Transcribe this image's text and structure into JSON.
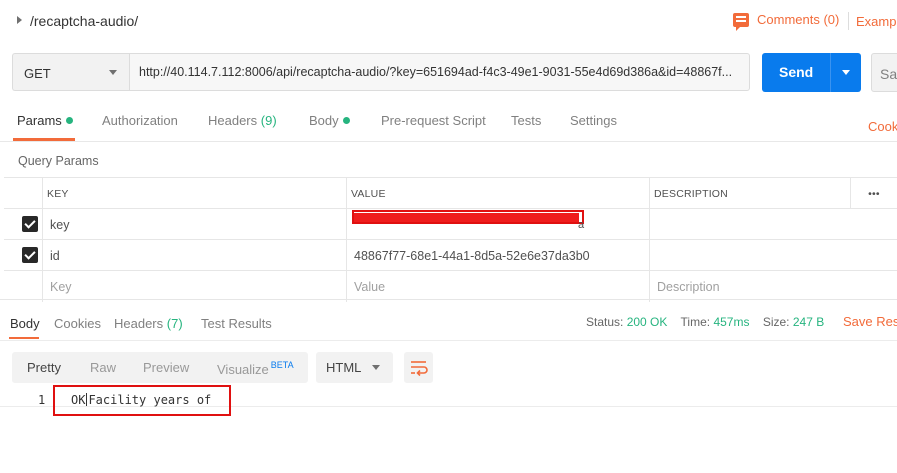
{
  "request": {
    "name": "/recaptcha-audio/",
    "comments_label": "Comments (0)",
    "examples_label": "Exampl",
    "method": "GET",
    "url": "http://40.114.7.112:8006/api/recaptcha-audio/?key=651694ad-f4c3-49e1-9031-55e4d69d386a&id=48867f...",
    "send_label": "Send",
    "save_label": "Sav"
  },
  "request_tabs": {
    "params": "Params",
    "authorization": "Authorization",
    "headers": "Headers",
    "headers_count": "(9)",
    "body": "Body",
    "prerequest": "Pre-request Script",
    "tests": "Tests",
    "settings": "Settings",
    "cookies": "Cooki"
  },
  "query_params": {
    "title": "Query Params",
    "columns": {
      "key": "KEY",
      "value": "VALUE",
      "description": "DESCRIPTION",
      "more": "•••"
    },
    "rows": [
      {
        "checked": true,
        "key": "key",
        "value": "",
        "redacted_tail": "a",
        "description": ""
      },
      {
        "checked": true,
        "key": "id",
        "value": "48867f77-68e1-44a1-8d5a-52e6e37da3b0",
        "description": ""
      }
    ],
    "placeholder": {
      "key": "Key",
      "value": "Value",
      "description": "Description"
    }
  },
  "response_tabs": {
    "body": "Body",
    "cookies": "Cookies",
    "headers": "Headers",
    "headers_count": "(7)",
    "test_results": "Test Results"
  },
  "response_status": {
    "status_label": "Status:",
    "status_value": "200 OK",
    "time_label": "Time:",
    "time_value": "457ms",
    "size_label": "Size:",
    "size_value": "247 B",
    "save_response": "Save Resp"
  },
  "body_view": {
    "pretty": "Pretty",
    "raw": "Raw",
    "preview": "Preview",
    "visualize": "Visualize",
    "beta": "BETA",
    "language": "HTML"
  },
  "code": {
    "line_number": "1",
    "text_before_cursor": "OK",
    "text_after_cursor": "Facility years of"
  },
  "colors": {
    "accent": "#f26b3a",
    "send_blue": "#097bed",
    "success_green": "#26b47f",
    "annotation_red": "#e01010"
  }
}
